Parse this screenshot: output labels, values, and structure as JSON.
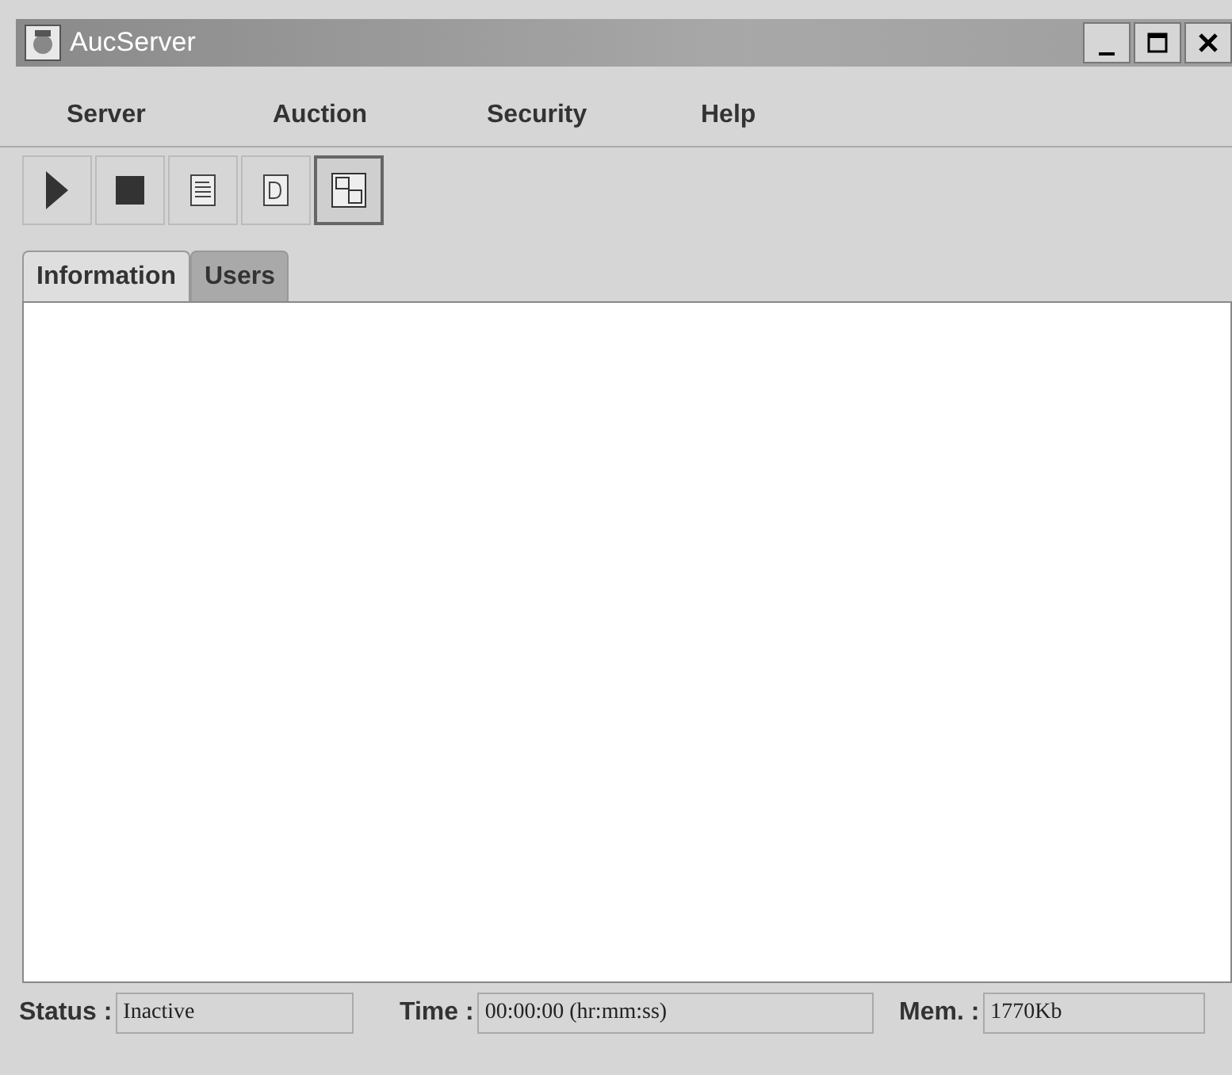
{
  "window": {
    "title": "AucServer"
  },
  "menu": [
    "Server",
    "Auction",
    "Security",
    "Help"
  ],
  "toolbar": [
    {
      "kind": "play",
      "pressed": false
    },
    {
      "kind": "stop",
      "pressed": false
    },
    {
      "kind": "list",
      "pressed": false
    },
    {
      "kind": "doc",
      "pressed": false
    },
    {
      "kind": "swap",
      "pressed": true
    }
  ],
  "tabs": [
    {
      "label": "Information",
      "selected": true
    },
    {
      "label": "Users",
      "selected": false
    }
  ],
  "status_bar": [
    {
      "label": "Status :",
      "value": "Inactive"
    },
    {
      "label": "Time :",
      "value": "00:00:00 (hr:mm:ss)"
    },
    {
      "label": "Mem. :",
      "value": "1770Kb"
    }
  ]
}
